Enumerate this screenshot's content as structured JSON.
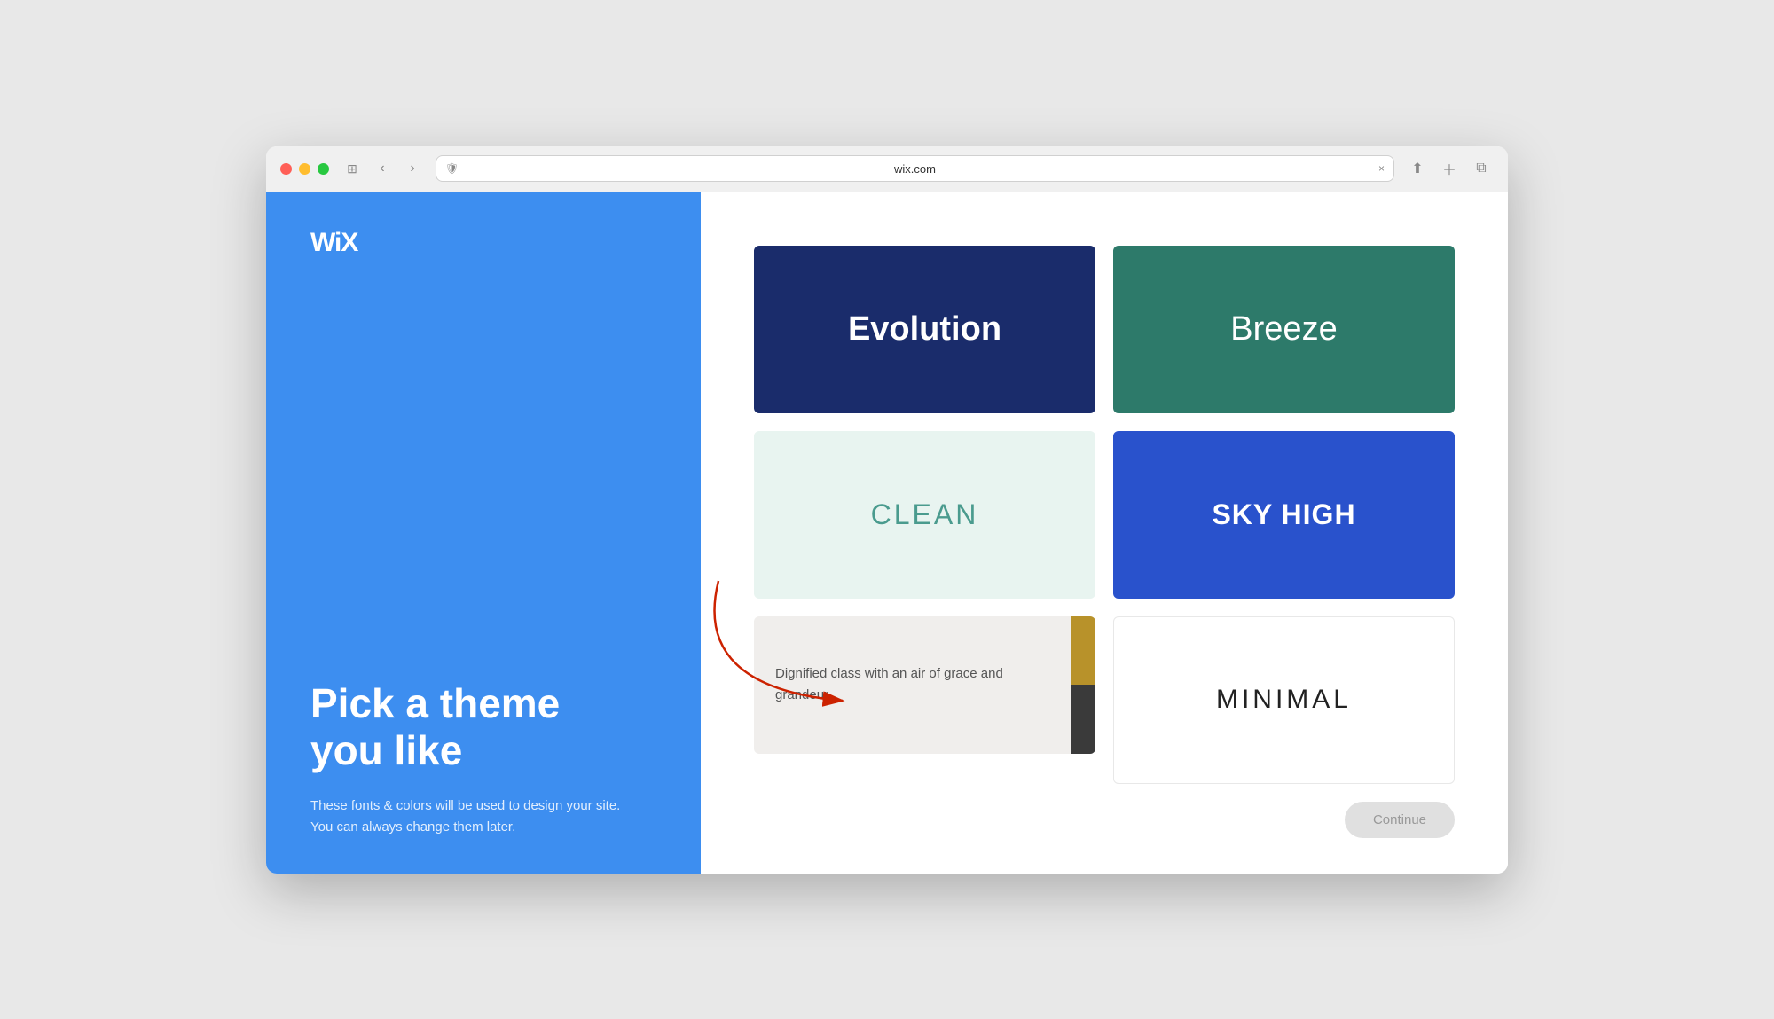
{
  "browser": {
    "url": "wix.com",
    "tab_close": "×"
  },
  "left_panel": {
    "logo": "WiX",
    "heading_line1": "Pick a theme",
    "heading_line2": "you like",
    "subtext_line1": "These fonts & colors will be used to design your site.",
    "subtext_line2": "You can always change them later."
  },
  "themes": [
    {
      "id": "evolution",
      "label": "Evolution",
      "class": "theme-evolution"
    },
    {
      "id": "breeze",
      "label": "Breeze",
      "class": "theme-breeze"
    },
    {
      "id": "clean",
      "label": "CLEAN",
      "class": "theme-clean"
    },
    {
      "id": "skyhigh",
      "label": "SKY HIGH",
      "class": "theme-skyhigh"
    },
    {
      "id": "grandeur",
      "label": "",
      "class": "theme-grandeur",
      "description": "Dignified class with an air of grace and grandeur"
    },
    {
      "id": "minimal",
      "label": "MINIMAL",
      "class": "theme-minimal"
    }
  ],
  "bottom": {
    "continue_label": "Continue"
  },
  "colors": {
    "blue_panel": "#3d8ef0",
    "evolution_bg": "#1a2c6b",
    "breeze_bg": "#2d7a6a",
    "clean_bg": "#e8f4f0",
    "clean_text": "#4a9b8e",
    "skyhigh_bg": "#2952cc",
    "grandeur_bg": "#f0eeec",
    "swatch_gold": "#b8922a",
    "swatch_dark": "#3a3a3a"
  }
}
